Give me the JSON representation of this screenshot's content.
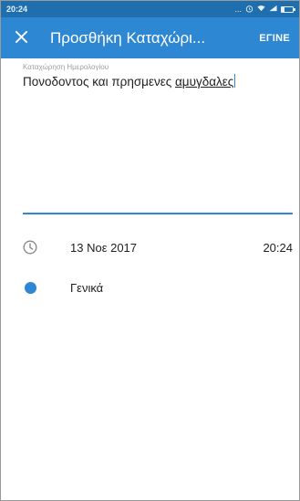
{
  "status_bar": {
    "time": "20:24",
    "icons": [
      "dots-icon",
      "alarm-icon",
      "wifi-icon",
      "signal-icon",
      "battery-icon"
    ],
    "dots": "...",
    "battery_level": 0.25
  },
  "app_bar": {
    "title": "Προσθήκη Καταχώρι...",
    "done_label": "ΕΓΙΝΕ",
    "close_icon": "close-icon",
    "color": "#2d87d2"
  },
  "entry": {
    "label": "Καταχώρηση Ημερολογίου",
    "text_prefix": "Πονοδοντος και πρησμενες ",
    "text_underlined": "αμυγδαλες"
  },
  "details": {
    "date": "13 Νοε 2017",
    "time": "20:24",
    "category": "Γενικά",
    "category_color": "#2d87d2"
  }
}
